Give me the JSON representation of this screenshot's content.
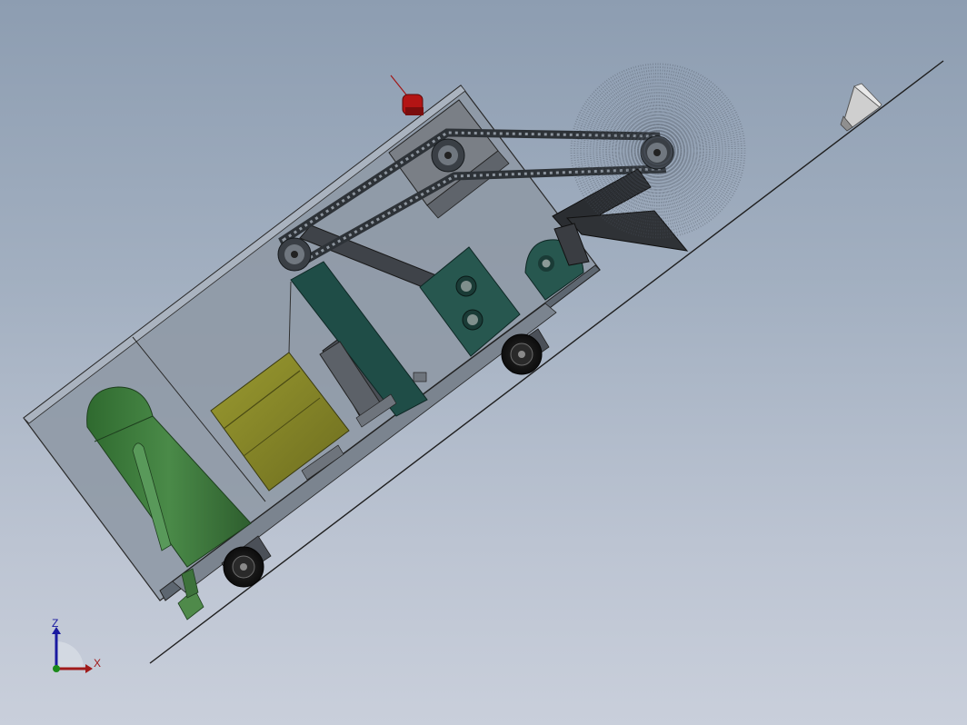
{
  "triad": {
    "z_label": "Z",
    "x_label": "X",
    "z_color": "#1a1aa0",
    "x_color": "#a01a1a",
    "origin_color": "#1a8a1a"
  },
  "colors": {
    "background_top": "#8d9db1",
    "background_bottom": "#c9cfdb",
    "enclosure": "#8f99a6",
    "tank": "#3e7a3e",
    "spool": "#8a8a2a",
    "bracket": "#1f4d47",
    "chain": "#3a3f45",
    "beacon": "#b31414"
  },
  "icons": {
    "wheels": "wheel-icon",
    "sprockets": "sprocket-icon",
    "brush": "rotary-brush",
    "nozzle": "spray-nozzle",
    "beacon": "warning-beacon"
  }
}
